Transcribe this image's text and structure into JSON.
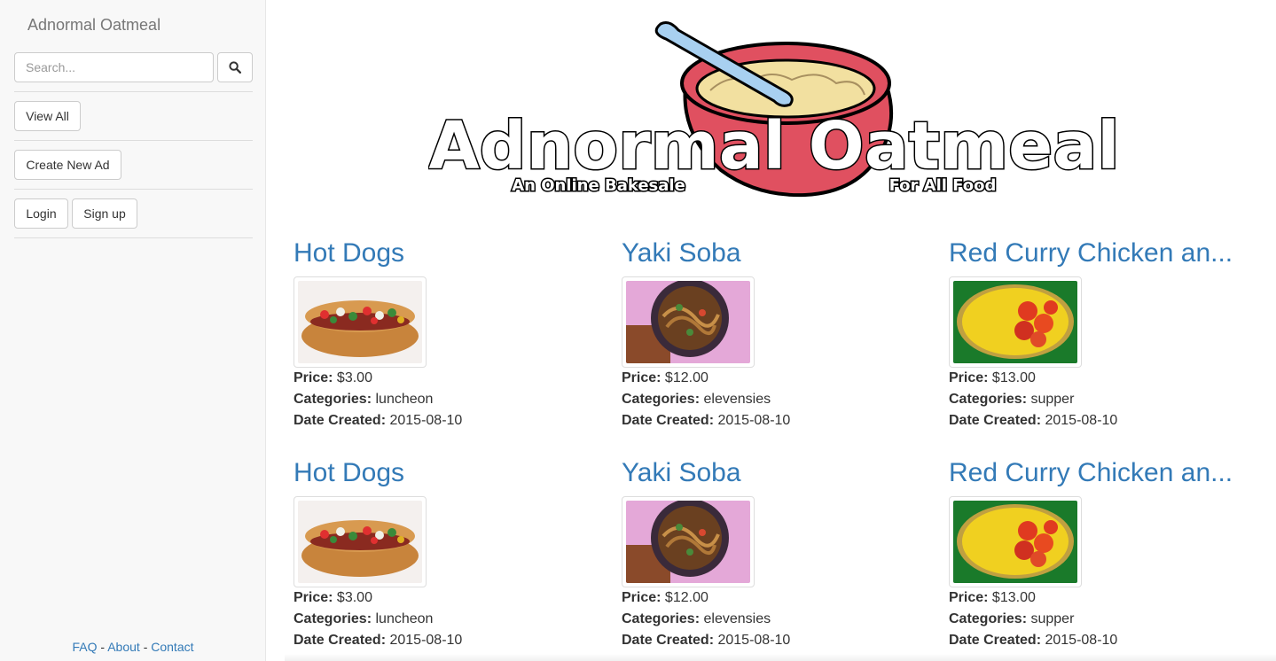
{
  "sidebar": {
    "brand": "Adnormal Oatmeal",
    "search": {
      "placeholder": "Search...",
      "value": ""
    },
    "buttons": {
      "view_all": "View All",
      "create_new_ad": "Create New Ad",
      "login": "Login",
      "sign_up": "Sign up"
    },
    "footer": {
      "faq": "FAQ",
      "about": "About",
      "contact": "Contact",
      "separator": "-"
    }
  },
  "logo": {
    "title": "Adnormal Oatmeal",
    "tagline_left": "An Online Bakesale",
    "tagline_right": "For All Food"
  },
  "labels": {
    "price": "Price:",
    "categories": "Categories:",
    "date_created": "Date Created:"
  },
  "ads": [
    {
      "title": "Hot Dogs",
      "price": "$3.00",
      "categories": "luncheon",
      "date": "2015-08-10",
      "image": "hot-dog"
    },
    {
      "title": "Yaki Soba",
      "price": "$12.00",
      "categories": "elevensies",
      "date": "2015-08-10",
      "image": "yaki-soba"
    },
    {
      "title": "Red Curry Chicken an...",
      "price": "$13.00",
      "categories": "supper",
      "date": "2015-08-10",
      "image": "red-curry-chicken"
    },
    {
      "title": "Hot Dogs",
      "price": "$3.00",
      "categories": "luncheon",
      "date": "2015-08-10",
      "image": "hot-dog"
    },
    {
      "title": "Yaki Soba",
      "price": "$12.00",
      "categories": "elevensies",
      "date": "2015-08-10",
      "image": "yaki-soba"
    },
    {
      "title": "Red Curry Chicken an...",
      "price": "$13.00",
      "categories": "supper",
      "date": "2015-08-10",
      "image": "red-curry-chicken"
    }
  ],
  "colors": {
    "link": "#337ab7",
    "bowl": "#e05060",
    "oatmeal": "#f2e0a0",
    "spoon": "#a8d0f0"
  }
}
